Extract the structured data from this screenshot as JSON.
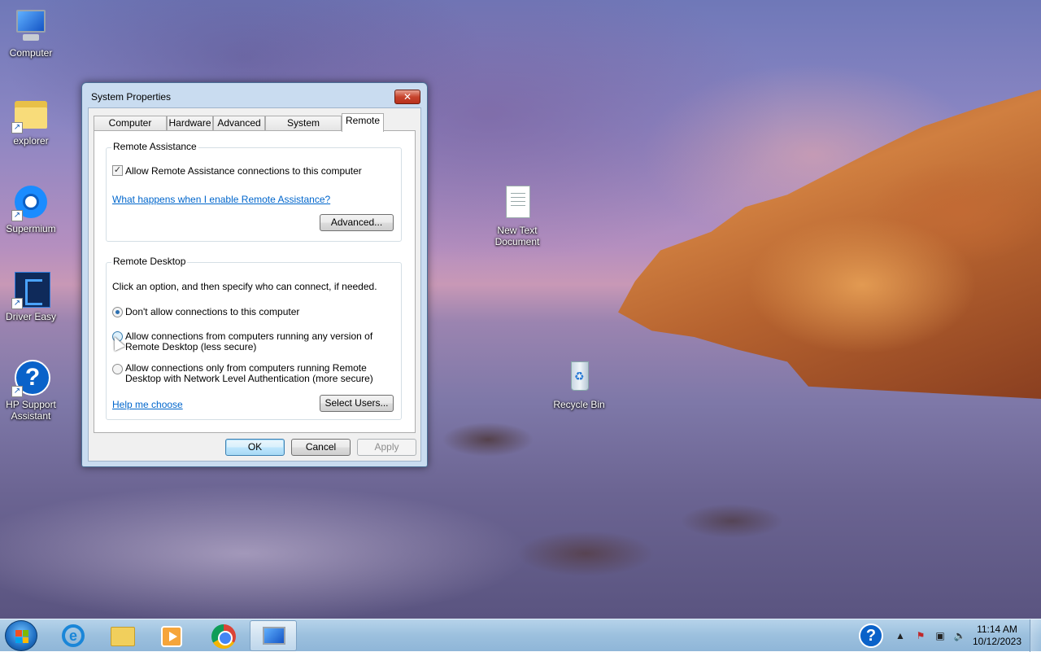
{
  "desktop": {
    "icons": [
      {
        "label": "Computer",
        "icon": "computer-icon"
      },
      {
        "label": "explorer",
        "icon": "folder-icon"
      },
      {
        "label": "Supermium",
        "icon": "supermium-icon"
      },
      {
        "label": "Driver Easy",
        "icon": "driver-easy-icon"
      },
      {
        "label": "HP Support Assistant",
        "icon": "help-icon"
      },
      {
        "label": "New Text Document",
        "icon": "text-file-icon"
      },
      {
        "label": "Recycle Bin",
        "icon": "recycle-bin-icon"
      }
    ]
  },
  "dialog": {
    "title": "System Properties",
    "close_label": "✕",
    "tabs": [
      "Computer Name",
      "Hardware",
      "Advanced",
      "System Protection",
      "Remote"
    ],
    "active_tab": "Remote",
    "remote_assistance": {
      "group_title": "Remote Assistance",
      "checkbox_label": "Allow Remote Assistance connections to this computer",
      "checkbox_checked": true,
      "link": "What happens when I enable Remote Assistance?",
      "advanced_button": "Advanced..."
    },
    "remote_desktop": {
      "group_title": "Remote Desktop",
      "instruction": "Click an option, and then specify who can connect, if needed.",
      "option1": "Don't allow connections to this computer",
      "option2_line1": "Allow connections from computers running any version of",
      "option2_line2": "Remote Desktop (less secure)",
      "option3_line1": "Allow connections only from computers running Remote",
      "option3_line2": "Desktop with Network Level Authentication (more secure)",
      "selected_option": "option1",
      "help_link": "Help me choose",
      "select_users_button": "Select Users..."
    },
    "footer": {
      "ok": "OK",
      "cancel": "Cancel",
      "apply": "Apply"
    }
  },
  "taskbar": {
    "apps": [
      "start",
      "internet-explorer",
      "file-explorer",
      "media-player",
      "chrome",
      "system-properties"
    ],
    "active_app": "system-properties",
    "clock": {
      "time": "11:14 AM",
      "date": "10/12/2023"
    }
  }
}
